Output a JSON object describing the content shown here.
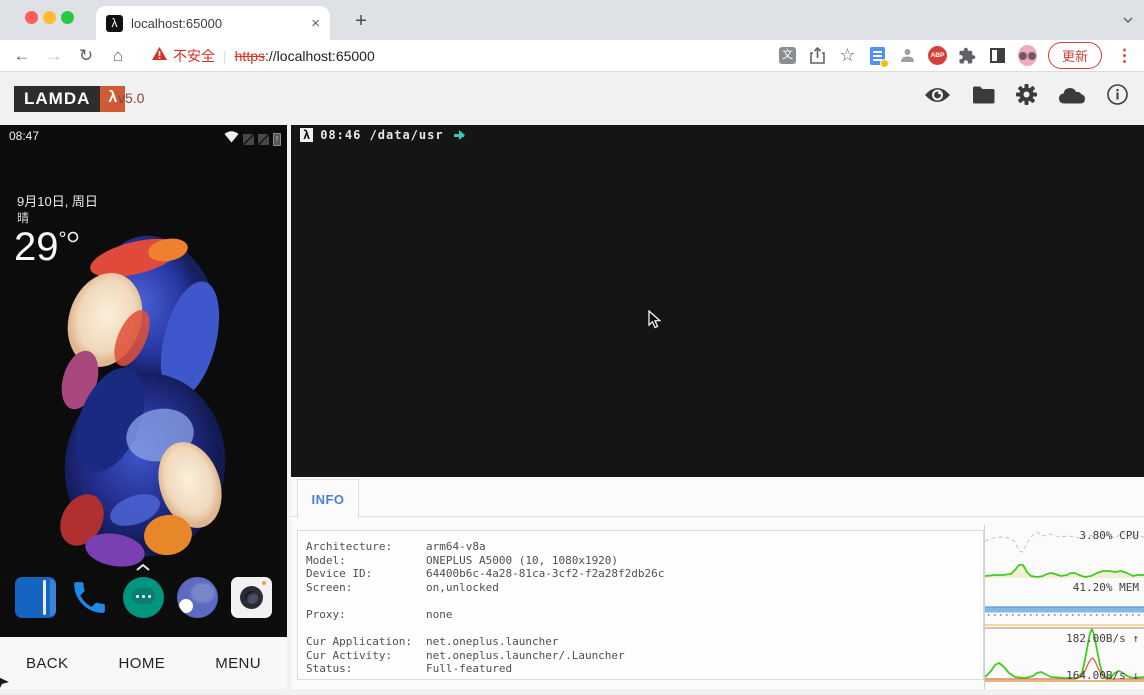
{
  "browser": {
    "tab_title": "localhost:65000",
    "tab_close": "×",
    "new_tab": "+",
    "nav": {
      "back": "←",
      "forward": "→",
      "reload": "↻",
      "home": "⌂"
    },
    "security_warning": "不安全",
    "url_scheme": "https",
    "url_rest": "://localhost:65000",
    "translate_glyph": "文",
    "star_glyph": "☆",
    "abp_label": "ABP",
    "update_button": "更新",
    "kebab_glyph": "⋮"
  },
  "header": {
    "logo_text": "LAMDA",
    "logo_lambda": "λ",
    "version": "v5.0"
  },
  "device": {
    "status_time": "08:47",
    "date": "9月10日, 周日",
    "weather": "晴",
    "temperature": "29",
    "temperature_degree": "°",
    "battery_alert": "!",
    "nav": {
      "back": "BACK",
      "home": "HOME",
      "menu": "MENU"
    }
  },
  "terminal": {
    "prompt_lambda": "λ",
    "prompt_text": "08:46 /data/usr"
  },
  "tabs": {
    "info": "INFO"
  },
  "device_info": {
    "rows": [
      {
        "label": "Architecture:",
        "value": "arm64-v8a"
      },
      {
        "label": "Model:",
        "value": "ONEPLUS A5000 (10, 1080x1920)"
      },
      {
        "label": "Device ID:",
        "value": "64400b6c-4a28-81ca-3cf2-f2a28f2db26c"
      },
      {
        "label": "Screen:",
        "value": "on,unlocked"
      },
      {
        "label": "",
        "value": ""
      },
      {
        "label": "Proxy:",
        "value": "none"
      },
      {
        "label": "",
        "value": ""
      },
      {
        "label": "Cur Application:",
        "value": "net.oneplus.launcher"
      },
      {
        "label": "Cur Activity:",
        "value": "net.oneplus.launcher/.Launcher"
      },
      {
        "label": "Status:",
        "value": "Full-featured"
      }
    ]
  },
  "performance": {
    "cpu_label": "3.80% CPU",
    "mem_label": "41.20% MEM",
    "net_up_label": "182.00B/s ↑",
    "net_down_label": "164.00B/s ↓",
    "series": {
      "cpu_dash": "0,16 8,13 16,12 24,13 30,17 34,26 38,27 42,18 46,12 52,7 58,11 66,9 74,12 84,11 94,13 102,10 112,12 122,10 130,13 138,8 146,13 152,10 159,12",
      "cpu_green": "0,51 10,50 18,50 26,49 30,45 34,40 38,40 42,47 46,51 52,52 58,51 62,49 66,48 70,49 76,51 82,50 86,48 90,48 94,50 100,52 106,51 112,48 118,46 124,46 130,47 136,46 142,48 148,51 152,50 159,50",
      "cpu_fill": "0,51 10,50 18,50 26,49 30,45 34,40 38,40 42,47 46,51 52,52 58,51 62,49 66,48 70,49 76,51 82,50 86,48 90,48 94,50 100,52 106,51 112,48 118,46 124,46 130,47 136,46 142,48 148,51 152,50 159,50 159,53 0,53",
      "mem_yellow": "0,100 159,100",
      "mem_red": "0,103 159,103",
      "net_green": "0,152 6,146 10,140 14,138 18,141 24,148 30,152 40,153 48,151 52,148 56,147 60,149 66,152 80,153 92,153 97,148 100,135 103,118 105,108 107,104 109,110 112,125 115,140 118,150 122,153 126,152 130,148 134,146 138,148 142,151 148,153 159,152",
      "net_red": "0,154 90,154 96,152 100,146 103,139 106,134 108,133 110,136 113,143 117,150 121,154 159,154",
      "net_orange": "0,156 159,156"
    }
  },
  "colors": {
    "accent_orange": "#d15a36",
    "chrome_red": "#d93025",
    "info_blue": "#4d7fd8",
    "terminal_cyan": "#38c9ba",
    "graph_green": "#3ecc1e"
  }
}
